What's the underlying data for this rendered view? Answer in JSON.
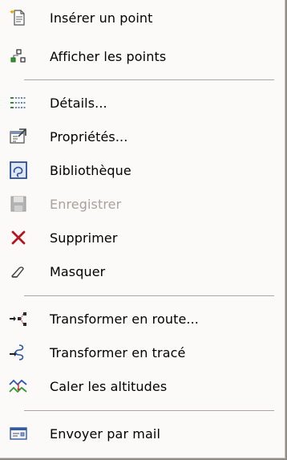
{
  "menu": {
    "items": [
      {
        "label": "Insérer un point",
        "icon": "insert-point-icon"
      },
      {
        "label": "Afficher les points",
        "icon": "show-points-icon"
      },
      {
        "label": "Détails...",
        "icon": "details-icon"
      },
      {
        "label": "Propriétés...",
        "icon": "properties-icon"
      },
      {
        "label": "Bibliothèque",
        "icon": "library-icon"
      },
      {
        "label": "Enregistrer",
        "icon": "save-icon",
        "disabled": true
      },
      {
        "label": "Supprimer",
        "icon": "delete-icon"
      },
      {
        "label": "Masquer",
        "icon": "hide-icon"
      },
      {
        "label": "Transformer en route...",
        "icon": "convert-to-route-icon"
      },
      {
        "label": "Transformer en tracé",
        "icon": "convert-to-track-icon"
      },
      {
        "label": "Caler les altitudes",
        "icon": "adjust-altitudes-icon"
      },
      {
        "label": "Envoyer par mail",
        "icon": "send-mail-icon"
      }
    ]
  }
}
